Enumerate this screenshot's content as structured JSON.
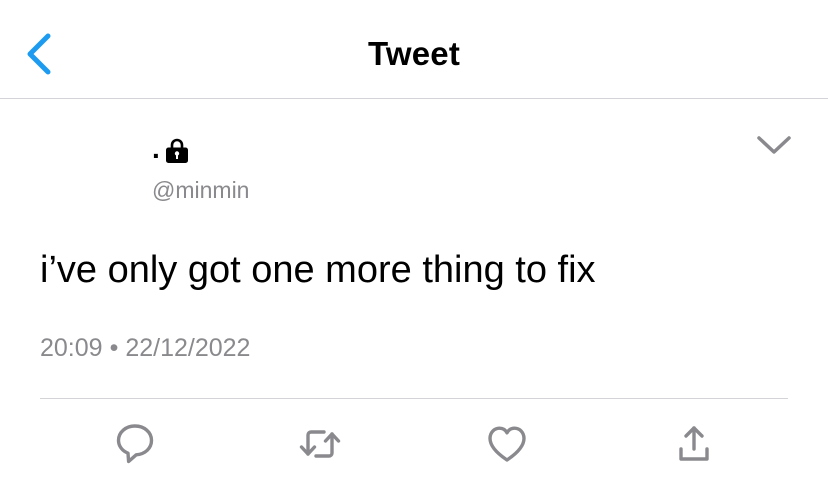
{
  "header": {
    "title": "Tweet",
    "back_icon": "chevron-left-icon"
  },
  "tweet": {
    "display_name": ".",
    "protected_icon": "lock-icon",
    "handle": "@minmin",
    "text": "i’ve only got one more thing to fix",
    "time": "20:09",
    "separator": "•",
    "date": "22/12/2022",
    "menu_icon": "chevron-down-icon"
  },
  "actions": [
    {
      "name": "reply",
      "icon": "reply-icon"
    },
    {
      "name": "retweet",
      "icon": "retweet-icon"
    },
    {
      "name": "like",
      "icon": "heart-icon"
    },
    {
      "name": "share",
      "icon": "share-icon"
    }
  ],
  "colors": {
    "accent": "#1d9bf0",
    "icon_gray": "#8a8a8e",
    "secondary_text": "#8a8a8e",
    "divider": "#d4d4d8"
  }
}
